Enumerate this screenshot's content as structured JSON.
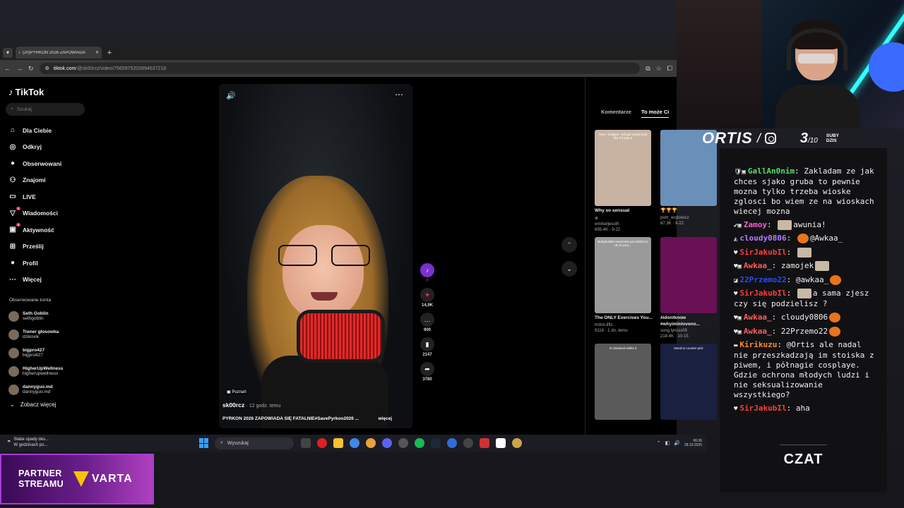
{
  "browser": {
    "tab_title": "(20)PYRKON 2026 ZAPOWIADA",
    "url_host": "tiktok.com",
    "url_path": "/@sk00rcz/video/7565975203994537218"
  },
  "tiktok": {
    "logo": "TikTok",
    "search_placeholder": "Szukaj",
    "nav": [
      {
        "label": "Dla Ciebie",
        "icon": "⌂"
      },
      {
        "label": "Odkryj",
        "icon": "◎"
      },
      {
        "label": "Obserwowani",
        "icon": "●"
      },
      {
        "label": "Znajomi",
        "icon": "⚇"
      },
      {
        "label": "LIVE",
        "icon": "▭"
      },
      {
        "label": "Wiadomości",
        "icon": "▽",
        "badge": "4"
      },
      {
        "label": "Aktywność",
        "icon": "▣",
        "badge": "8"
      },
      {
        "label": "Prześlij",
        "icon": "⊞"
      },
      {
        "label": "Profil",
        "icon": "●"
      },
      {
        "label": "Więcej",
        "icon": "⋯"
      }
    ],
    "followed_title": "Obserwowane konta",
    "followed": [
      {
        "name": "Seth Goblin",
        "handle": "sethgoblin"
      },
      {
        "name": "Trener głosowka",
        "handle": "dzikoxik"
      },
      {
        "name": "bigpro427",
        "handle": "bigpro427"
      },
      {
        "name": "HigherUpWellness",
        "handle": "higherupwellness"
      },
      {
        "name": "dannyguo.md",
        "handle": "dannyguo.md"
      }
    ],
    "see_more": "Zobacz więcej",
    "video": {
      "location": "Poznań",
      "author": "sk00rcz",
      "time": "· 12 godz. temu",
      "description": "PYRKON 2026 ZAPOWIADA SIĘ FATALNIE#SavePyrkon2026 ...",
      "more": "więcej",
      "likes": "14,9K",
      "comments": "900",
      "saves": "2147",
      "shares": "3780"
    },
    "right_tabs": [
      "Komentarze",
      "To może Ci"
    ],
    "cards": [
      {
        "caption": "How I imagine i will get would look like if it was a",
        "title": "Why so sensual",
        "icon": "⊗",
        "author": "emilseljesoth",
        "meta": "695.4K · 9-22",
        "color": "#c8b3a2"
      },
      {
        "caption": "",
        "title": "🏆🏆🏆",
        "icon": "",
        "author": "piotr_wojtowicz",
        "meta": "87.3K · 9-22",
        "color": "#6a8fb8"
      },
      {
        "caption": "Bodybuilder exercises you NEED to do in your...",
        "title": "The ONLY Exercises You...",
        "icon": "",
        "author": "trstnn.lifts",
        "meta": "9116 · 1 dn. temu",
        "color": "#9a9a9a"
      },
      {
        "caption": "",
        "title": "#idontknow #whyiminloveno...",
        "icon": "",
        "author": "song.lyricss05",
        "meta": "218.4K · 10-15",
        "color": "#6a1055"
      },
      {
        "caption": "Si classical unlike it",
        "title": "",
        "icon": "",
        "author": "",
        "meta": "",
        "color": "#5a5a5a"
      },
      {
        "caption": "Need to counter pick",
        "title": "",
        "icon": "",
        "author": "",
        "meta": "",
        "color": "#1a2040"
      }
    ]
  },
  "taskbar": {
    "weather_title": "Słabe opady des...",
    "weather_sub": "W godzinach po...",
    "search_placeholder": "Wyszukaj",
    "clock_time": "06:36",
    "clock_date": "28.10.2025"
  },
  "partner": {
    "line1": "PARTNER",
    "line2": "STREAMU",
    "brand": "VARTA"
  },
  "overlay": {
    "name": "ORTIS",
    "sep": "/",
    "subs_now": "3",
    "subs_goal": "/10",
    "subs_label1": "SUBY",
    "subs_label2": "DZIS"
  },
  "chat": {
    "title": "CZAT",
    "messages": [
      {
        "badges": "🛡▣",
        "user": "GallAn0nim",
        "color": "#4fe06a",
        "text": "Zakladam ze jak chces sjako gruba to pewnie mozna tylko trzeba wioske zglosci bo wiem ze na wioskach wiecej mozna",
        "emote": "",
        "after": ""
      },
      {
        "badges": "✔▣",
        "user": "Zamoy",
        "color": "#ff5ad6",
        "text": "",
        "emote": "img",
        "after": "awunia!"
      },
      {
        "badges": "◭",
        "user": "cloudy0806",
        "color": "#b27bff",
        "text": "",
        "emote": "pump",
        "after": "@Awkaa_"
      },
      {
        "badges": "♥",
        "user": "SirJakubIl",
        "color": "#ff3c3c",
        "text": "",
        "emote": "img",
        "after": ""
      },
      {
        "badges": "♥▣",
        "user": "Awkaa_",
        "color": "#ff5c5c",
        "text": "zamojek",
        "emote": "img",
        "after": ""
      },
      {
        "badges": "◪",
        "user": "22Przemo22",
        "color": "#2a4aff",
        "text": "@awkaa_",
        "emote": "pump",
        "after": ""
      },
      {
        "badges": "♥",
        "user": "SirJakubIl",
        "color": "#ff3c3c",
        "text": "",
        "emote": "img",
        "after": "a sama zjesz czy się podzielisz ?"
      },
      {
        "badges": "♥▣",
        "user": "Awkaa_",
        "color": "#ff5c5c",
        "text": "cloudy0806",
        "emote": "pump",
        "after": ""
      },
      {
        "badges": "♥▣",
        "user": "Awkaa_",
        "color": "#ff5c5c",
        "text": "22Przemo22",
        "emote": "pump",
        "after": ""
      },
      {
        "badges": "▬",
        "user": "Kirikuzu",
        "color": "#ff8a3c",
        "text": "@Ortis ale nadal nie przeszkadzają im stoiska z piwem, i półnagie cosplaye. Gdzie ochrona młodych ludzi i nie seksualizowanie wszystkiego?",
        "emote": "",
        "after": ""
      },
      {
        "badges": "♥",
        "user": "SirJakubIl",
        "color": "#ff3c3c",
        "text": "aha",
        "emote": "",
        "after": ""
      }
    ]
  }
}
